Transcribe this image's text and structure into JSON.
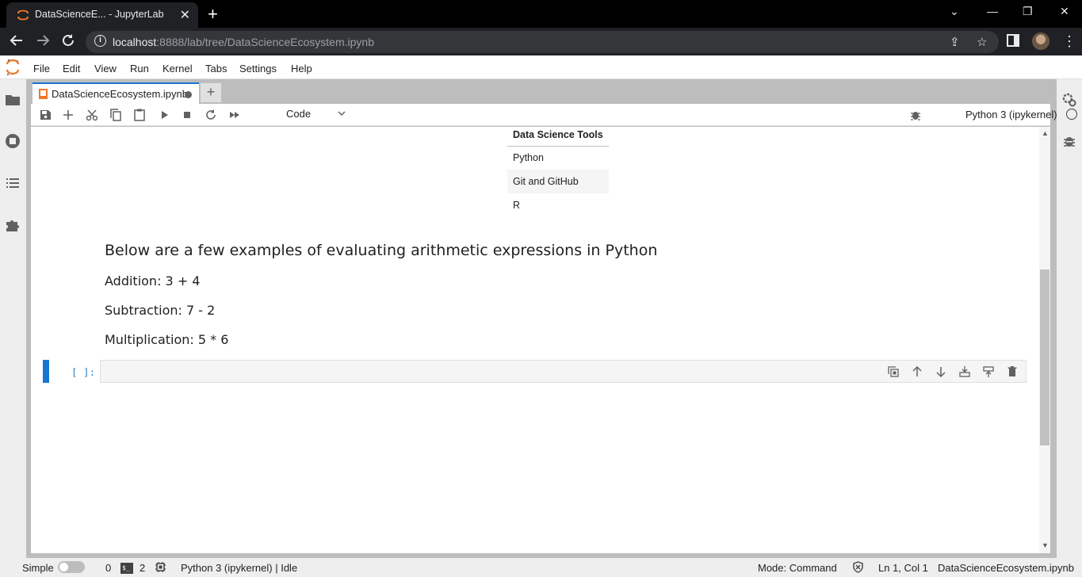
{
  "browser": {
    "tab_title": "DataScienceE... - JupyterLab",
    "url_host": "localhost",
    "url_rest": ":8888/lab/tree/DataScienceEcosystem.ipynb"
  },
  "menu": [
    "File",
    "Edit",
    "View",
    "Run",
    "Kernel",
    "Tabs",
    "Settings",
    "Help"
  ],
  "document": {
    "tab_label": "DataScienceEcosystem.ipynb",
    "cell_type": "Code",
    "kernel": "Python 3 (ipykernel)"
  },
  "table": {
    "header": "Data Science Tools",
    "rows": [
      "Python",
      "Git and GitHub",
      "R"
    ]
  },
  "markdown": {
    "heading": "Below are a few examples of evaluating arithmetic expressions in Python",
    "lines": [
      "Addition: 3 + 4",
      "Subtraction: 7 - 2",
      "Multiplication: 5 * 6"
    ]
  },
  "code_cell": {
    "prompt": "[ ]:"
  },
  "status": {
    "mode_label": "Simple",
    "count_a": "0",
    "count_b": "2",
    "kernel_status": "Python 3 (ipykernel) | Idle",
    "mode": "Mode: Command",
    "position": "Ln 1, Col 1",
    "filename": "DataScienceEcosystem.ipynb"
  }
}
